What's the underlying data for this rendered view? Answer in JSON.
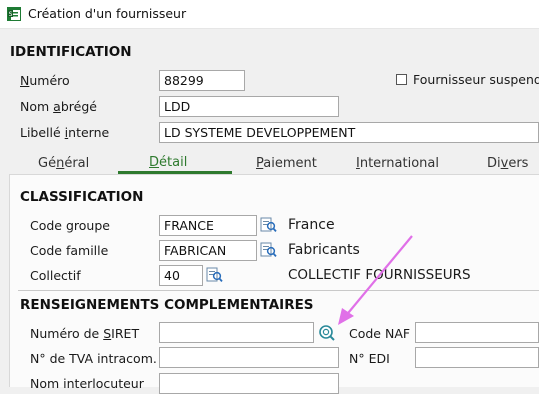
{
  "window": {
    "title": "Création d'un fournisseur"
  },
  "identification": {
    "title": "IDENTIFICATION",
    "numero_label": "Numéro",
    "numero_value": "88299",
    "nom_abrege_label": "Nom abrégé",
    "nom_abrege_value": "LDD",
    "libelle_label": "Libellé interne",
    "libelle_value": "LD SYSTEME DEVELOPPEMENT",
    "suspendu_label": "Fournisseur suspendu"
  },
  "tabs": [
    {
      "label": "Général"
    },
    {
      "label": "Détail"
    },
    {
      "label": "Paiement"
    },
    {
      "label": "International"
    },
    {
      "label": "Divers"
    }
  ],
  "classification": {
    "title": "CLASSIFICATION",
    "code_groupe_label": "Code groupe",
    "code_groupe_value": "FRANCE",
    "code_groupe_desc": "France",
    "code_famille_label": "Code famille",
    "code_famille_value": "FABRICAN",
    "code_famille_desc": "Fabricants",
    "collectif_label": "Collectif",
    "collectif_value": "40",
    "collectif_desc": "COLLECTIF FOURNISSEURS"
  },
  "renseignements": {
    "title": "RENSEIGNEMENTS COMPLEMENTAIRES",
    "siret_label": "Numéro de SIRET",
    "siret_value": "",
    "code_naf_label": "Code NAF",
    "code_naf_value": "",
    "tva_label": "N° de TVA intracom.",
    "tva_value": "",
    "edi_label": "N° EDI",
    "edi_value": "",
    "interlocuteur_label": "Nom interlocuteur"
  },
  "colors": {
    "accent": "#2e7a2e",
    "annotation_arrow": "#e070e8"
  },
  "icons": [
    "app-icon",
    "lookup-icon",
    "annotation-arrow"
  ]
}
